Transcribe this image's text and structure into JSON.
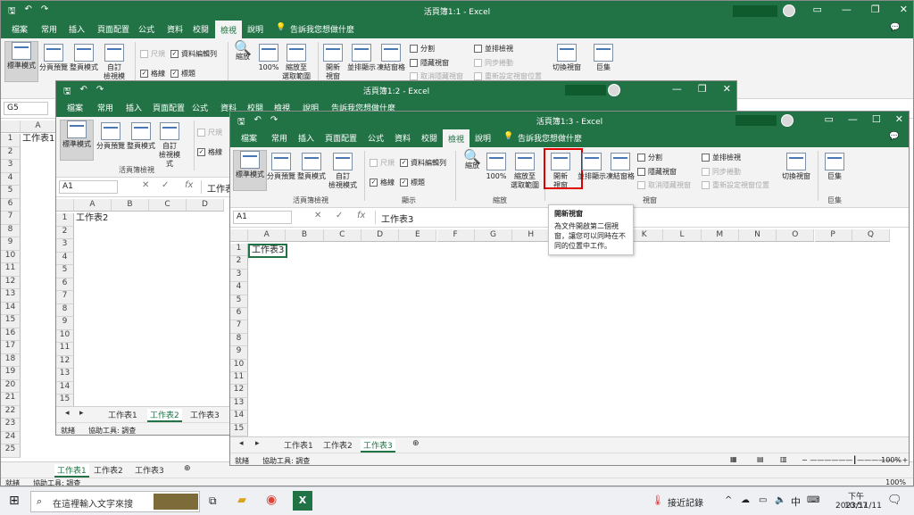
{
  "app": {
    "win1": {
      "title": "活頁簿1:1 - Excel",
      "tabs": [
        "檔案",
        "常用",
        "插入",
        "頁面配置",
        "公式",
        "資料",
        "校閱",
        "檢視",
        "說明"
      ],
      "active_tab": "檢視",
      "tellme": "告訴我您想做什麼",
      "ribbon": [
        "標準模式",
        "分頁預覽",
        "整頁模式",
        "自訂\n檢視模式",
        "縮放",
        "100%",
        "縮放至\n選取範圍",
        "開新\n視窗",
        "並排顯示",
        "凍結窗格",
        "切換視窗",
        "巨集"
      ],
      "checks": {
        "ruler": "尺規",
        "formula_bar": "資料編輯列",
        "gridlines": "格線",
        "headings": "標題"
      },
      "window_opts": [
        "分割",
        "隱藏視窗",
        "取消隱藏視窗",
        "並排檢視",
        "同步捲動",
        "重新設定視窗位置"
      ],
      "namebox": "G5",
      "col_a": "A",
      "cell_a1": "工作表1",
      "sheets": [
        "工作表1",
        "工作表2",
        "工作表3"
      ],
      "status_ready": "就緒",
      "accessibility": "協助工具: 調查",
      "zoom": "100%"
    },
    "win2": {
      "title": "活頁簿1:2 - Excel",
      "tabs": [
        "檔案",
        "常用",
        "插入",
        "頁面配置",
        "公式",
        "資料",
        "校閱",
        "檢視",
        "說明"
      ],
      "tellme": "告訴我您想做什麼",
      "ribbon": [
        "標準模式",
        "分頁預覽",
        "整頁模式",
        "自訂\n檢視模式"
      ],
      "group_label": "活頁簿檢視",
      "checks": {
        "ruler": "尺規",
        "gridlines": "格線"
      },
      "namebox": "A1",
      "fx_value": "工作表2",
      "cols": [
        "A",
        "B",
        "C",
        "D"
      ],
      "cell_a1": "工作表2",
      "sheets": [
        "工作表1",
        "工作表2",
        "工作表3"
      ],
      "status_ready": "就緒",
      "accessibility": "協助工具: 調查"
    },
    "win3": {
      "title": "活頁簿1:3 - Excel",
      "tabs": [
        "檔案",
        "常用",
        "插入",
        "頁面配置",
        "公式",
        "資料",
        "校閱",
        "檢視",
        "說明"
      ],
      "active_tab": "檢視",
      "tellme": "告訴我您想做什麼",
      "ribbon": [
        "標準模式",
        "分頁預覽",
        "整頁模式",
        "自訂\n檢視模式",
        "縮放",
        "100%",
        "縮放至\n選取範圍",
        "開新\n視窗",
        "並排顯示",
        "凍結窗格",
        "切換視窗",
        "巨集"
      ],
      "groups": [
        "活頁簿檢視",
        "顯示",
        "縮放",
        "視窗",
        "巨集"
      ],
      "checks": {
        "ruler": "尺規",
        "formula_bar": "資料編輯列",
        "gridlines": "格線",
        "headings": "標題"
      },
      "window_opts": [
        "分割",
        "隱藏視窗",
        "取消隱藏視窗",
        "並排檢視",
        "同步捲動",
        "重新設定視窗位置"
      ],
      "tooltip_title": "開新視窗",
      "tooltip_body": "為文件開啟第二個視窗，讓您可以同時在不同的位置中工作。",
      "namebox": "A1",
      "fx_value": "工作表3",
      "cols": [
        "A",
        "B",
        "C",
        "D",
        "E",
        "F",
        "G",
        "H",
        "I",
        "J",
        "K",
        "L",
        "M",
        "N",
        "O",
        "P",
        "Q"
      ],
      "cell_a1": "工作表3",
      "sheets": [
        "工作表1",
        "工作表2",
        "工作表3"
      ],
      "status_ready": "就緒",
      "accessibility": "協助工具: 調查",
      "zoom": "100%"
    }
  },
  "taskbar": {
    "search_placeholder": "在這裡輸入文字來搜",
    "notify": "接近記錄",
    "ime": "中",
    "time": "下午 10:57",
    "date": "2023/11/11"
  },
  "colors": {
    "excel_green": "#217346",
    "highlight": "#e00000"
  }
}
